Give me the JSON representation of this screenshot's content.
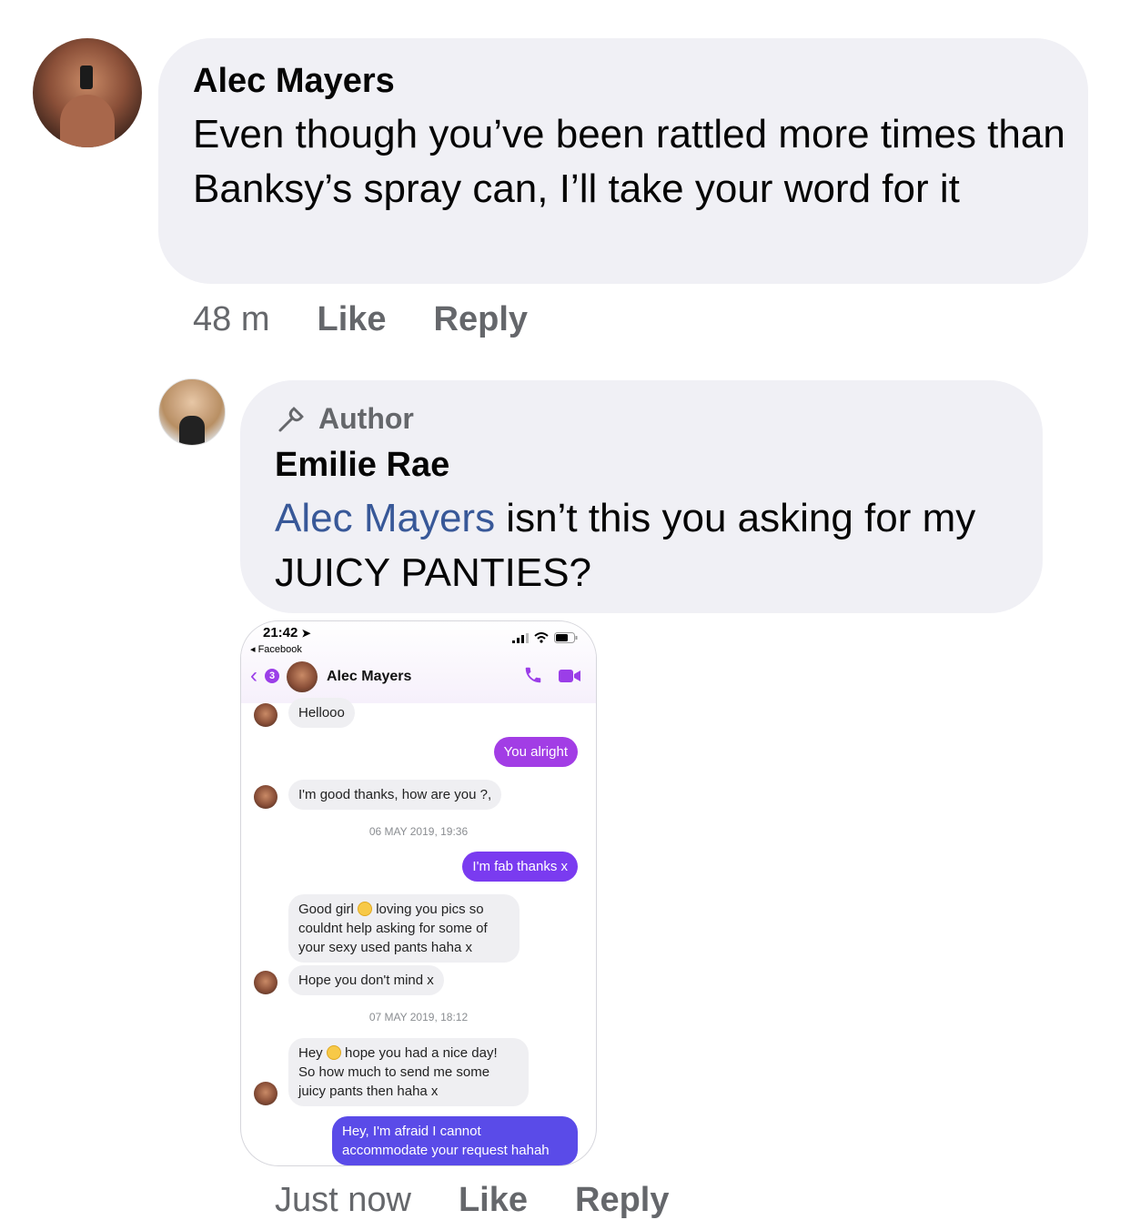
{
  "comment1": {
    "author": "Alec Mayers",
    "text": "Even though you’ve been rattled more times than Banksy’s spray can, I’ll take your word for it",
    "time": "48 m",
    "like": "Like",
    "reply": "Reply"
  },
  "comment2": {
    "badge": "Author",
    "author": "Emilie Rae",
    "mention": "Alec Mayers",
    "text": " isn’t this you asking for my JUICY PANTIES?",
    "time": "Just now",
    "like": "Like",
    "reply": "Reply"
  },
  "screenshot": {
    "status_time": "21:42",
    "back_app": "◂ Facebook",
    "unread_count": "3",
    "contact": "Alec Mayers",
    "messages": [
      {
        "text": "Hellooo"
      },
      {
        "text": "You alright"
      },
      {
        "text": "I'm good thanks, how are you ?,"
      },
      {
        "text": "06 MAY 2019, 19:36"
      },
      {
        "text": "I'm fab thanks x"
      },
      {
        "text_a": "Good girl ",
        "text_b": " loving you pics  so\ncouldnt help asking for some of\nyour sexy used pants haha x"
      },
      {
        "text": "Hope you don't mind x"
      },
      {
        "text": "07 MAY 2019, 18:12"
      },
      {
        "text_a": "Hey ",
        "text_b": " hope you had a nice day!\nSo how much to send me some\njuicy pants then haha x"
      },
      {
        "text": "Hey, I'm afraid I cannot\naccommodate your request hahah"
      }
    ]
  },
  "colors": {
    "bubble_bg": "#f0f0f5",
    "mention": "#385898",
    "meta_gray": "#65676b",
    "messenger_purple": "#9b3ee8"
  }
}
